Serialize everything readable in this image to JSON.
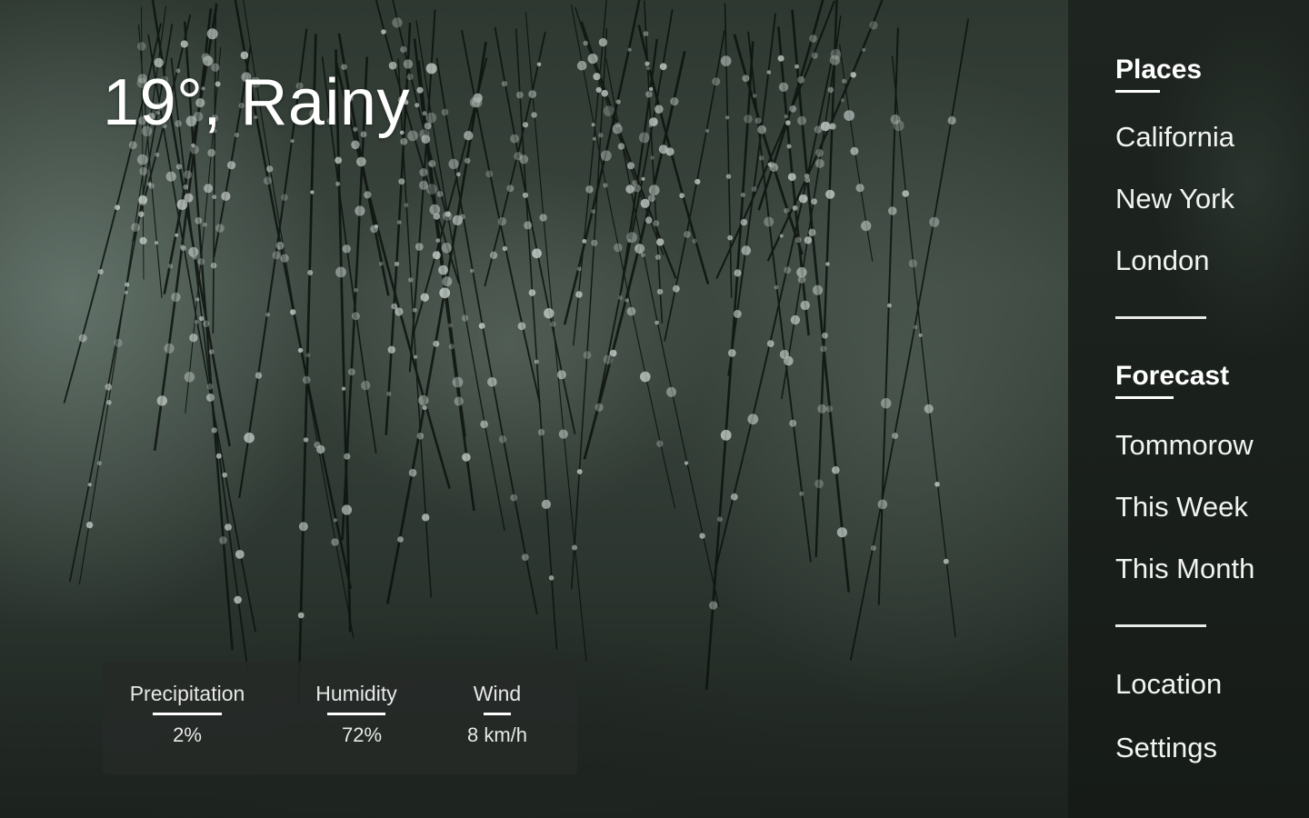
{
  "weather": {
    "headline": "19°, Rainy"
  },
  "stats": {
    "precipitation": {
      "label": "Precipitation",
      "value": "2%"
    },
    "humidity": {
      "label": "Humidity",
      "value": "72%"
    },
    "wind": {
      "label": "Wind",
      "value": "8 km/h"
    }
  },
  "sidebar": {
    "places": {
      "title": "Places",
      "items": [
        "California",
        "New York",
        "London"
      ]
    },
    "forecast": {
      "title": "Forecast",
      "items": [
        "Tommorow",
        "This Week",
        "This Month"
      ]
    },
    "footer_items": [
      "Location",
      "Settings"
    ]
  },
  "colors": {
    "text": "#ffffff",
    "panel": "#262a28",
    "sidebar": "#1a201c"
  }
}
